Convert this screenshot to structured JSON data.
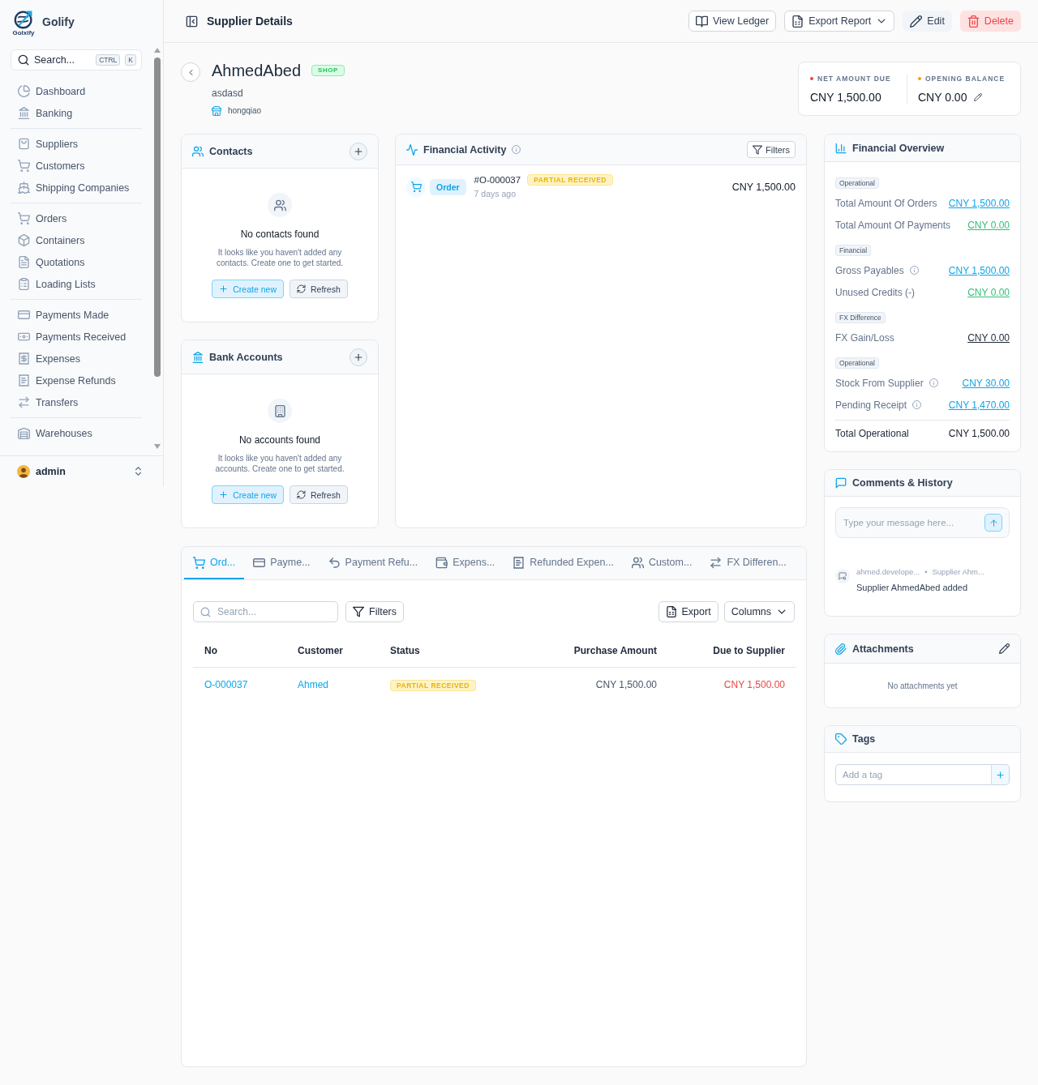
{
  "sidebar": {
    "logo_caption": "Golxify",
    "app_name": "Golify",
    "search": {
      "label": "Search...",
      "shortcut": [
        "CTRL",
        "K"
      ]
    },
    "groups": [
      {
        "items": [
          {
            "label": "Dashboard",
            "selected": false
          },
          {
            "label": "Banking",
            "selected": false
          }
        ]
      },
      {
        "items": [
          {
            "label": "Suppliers",
            "selected": false
          },
          {
            "label": "Customers",
            "selected": false
          },
          {
            "label": "Shipping Companies",
            "selected": false
          }
        ]
      },
      {
        "items": [
          {
            "label": "Orders",
            "selected": false
          },
          {
            "label": "Containers",
            "selected": false
          },
          {
            "label": "Quotations",
            "selected": false
          },
          {
            "label": "Loading Lists",
            "selected": false
          }
        ]
      },
      {
        "items": [
          {
            "label": "Payments Made",
            "selected": false
          },
          {
            "label": "Payments Received",
            "selected": false
          },
          {
            "label": "Expenses",
            "selected": false
          },
          {
            "label": "Expense Refunds",
            "selected": false
          },
          {
            "label": "Transfers",
            "selected": false
          }
        ]
      },
      {
        "items": [
          {
            "label": "Warehouses",
            "selected": false
          }
        ]
      }
    ],
    "user": {
      "name": "admin"
    }
  },
  "header": {
    "title": "Supplier Details",
    "actions": [
      {
        "label": "View Ledger",
        "kind": "outline"
      },
      {
        "label": "Export Report",
        "kind": "dropdown"
      },
      {
        "label": "Edit",
        "kind": "soft"
      },
      {
        "label": "Delete",
        "kind": "danger"
      }
    ]
  },
  "profile": {
    "name": "AhmedAbed",
    "badge": "SHOP",
    "subtitle": "asdasd",
    "location": "hongqiao",
    "balances": [
      {
        "label": "NET AMOUNT DUE",
        "value": "CNY 1,500.00",
        "color": "#ef4444",
        "editable": false
      },
      {
        "label": "OPENING BALANCE",
        "value": "CNY 0.00",
        "color": "#f59e0b",
        "editable": true
      }
    ]
  },
  "contacts": {
    "title": "Contacts",
    "empty_title": "No contacts found",
    "empty_text": "It looks like you haven't added any contacts. Create one to get started.",
    "actions": [
      {
        "label": "Create new",
        "kind": "primary"
      },
      {
        "label": "Refresh",
        "kind": "secondary"
      }
    ]
  },
  "bank_accounts": {
    "title": "Bank Accounts",
    "empty_title": "No accounts found",
    "empty_text": "It looks like you haven't added any accounts. Create one to get started.",
    "actions": [
      {
        "label": "Create new",
        "kind": "primary"
      },
      {
        "label": "Refresh",
        "kind": "secondary"
      }
    ]
  },
  "financial_activity": {
    "title": "Financial Activity",
    "filter_label": "Filters",
    "items": [
      {
        "type_label": "Order",
        "number": "#O-000037",
        "status": "PARTIAL RECEIVED",
        "time": "7 days ago",
        "amount": "CNY 1,500.00"
      }
    ]
  },
  "financial_overview": {
    "title": "Financial Overview",
    "sections": [
      {
        "tag": "Operational",
        "rows": [
          {
            "label": "Total Amount Of Orders",
            "info": false,
            "value": "CNY 1,500.00",
            "color": "#0ea5e9"
          },
          {
            "label": "Total Amount Of Payments",
            "info": false,
            "value": "CNY 0.00",
            "color": "#34c07a"
          }
        ]
      },
      {
        "tag": "Financial",
        "rows": [
          {
            "label": "Gross Payables",
            "info": true,
            "value": "CNY 1,500.00",
            "color": "#0ea5e9"
          },
          {
            "label": "Unused Credits (-)",
            "info": false,
            "value": "CNY 0.00",
            "color": "#34c07a"
          }
        ]
      },
      {
        "tag": "FX Difference",
        "rows": [
          {
            "label": "FX Gain/Loss",
            "info": false,
            "value": "CNY 0.00",
            "color": "#1e293b"
          }
        ]
      },
      {
        "tag": "Operational",
        "rows": [
          {
            "label": "Stock From Supplier",
            "info": true,
            "value": "CNY 30.00",
            "color": "#0ea5e9"
          },
          {
            "label": "Pending Receipt",
            "info": true,
            "value": "CNY 1,470.00",
            "color": "#0ea5e9"
          }
        ]
      }
    ],
    "total": {
      "label": "Total Operational",
      "value": "CNY 1,500.00"
    }
  },
  "comments": {
    "title": "Comments & History",
    "placeholder": "Type your message here...",
    "entries": [
      {
        "author": "ahmed.develope...",
        "separator": "•",
        "subject": "Supplier Ahm...",
        "message": "Supplier AhmedAbed added"
      }
    ]
  },
  "attachments": {
    "title": "Attachments",
    "empty_text": "No attachments yet"
  },
  "tags": {
    "title": "Tags",
    "placeholder": "Add a tag"
  },
  "record_tabs": [
    {
      "label": "Ord...",
      "selected": true
    },
    {
      "label": "Payme...",
      "selected": false
    },
    {
      "label": "Payment Refu...",
      "selected": false
    },
    {
      "label": "Expens...",
      "selected": false
    },
    {
      "label": "Refunded Expen...",
      "selected": false
    },
    {
      "label": "Custom...",
      "selected": false
    },
    {
      "label": "FX Differen...",
      "selected": false
    }
  ],
  "toolbar": {
    "search_placeholder": "Search...",
    "filter_label": "Filters",
    "export_label": "Export",
    "columns_label": "Columns"
  },
  "table": {
    "columns": [
      "No",
      "Customer",
      "Status",
      "Purchase Amount",
      "Due to Supplier"
    ],
    "rows": [
      [
        "O-000037",
        "Ahmed",
        "PARTIAL RECEIVED",
        "CNY 1,500.00",
        "CNY 1,500.00"
      ]
    ]
  }
}
